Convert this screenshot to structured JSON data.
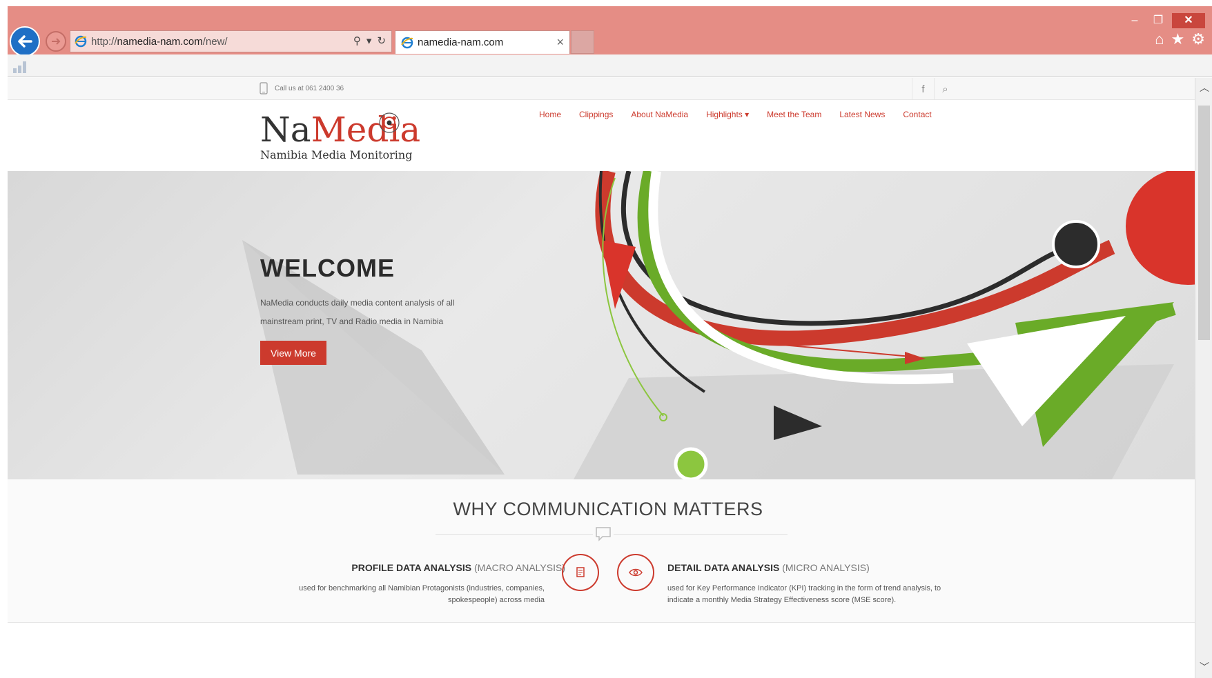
{
  "browser": {
    "address": {
      "prefix": "http://",
      "host": "namedia-nam.com",
      "path": "/new/"
    },
    "tab_title": "namedia-nam.com",
    "tab_close": "×",
    "window_buttons": {
      "minimize": "‒",
      "restore": "❐",
      "close": "✕"
    },
    "icons": {
      "back": "back-arrow-icon",
      "forward": "forward-arrow-icon",
      "home": "home-icon",
      "favorites": "star-icon",
      "settings": "gear-icon"
    }
  },
  "topbar": {
    "phone_text": "Call us at 061 2400 36",
    "facebook_icon": "f",
    "search_icon": "⌕"
  },
  "logo": {
    "na": "Na",
    "media": "Media",
    "tagline": "Namibia Media Monitoring"
  },
  "nav": [
    {
      "label": "Home"
    },
    {
      "label": "Clippings"
    },
    {
      "label": "About NaMedia"
    },
    {
      "label": "Highlights ▾"
    },
    {
      "label": "Meet the Team"
    },
    {
      "label": "Latest News"
    },
    {
      "label": "Contact"
    }
  ],
  "hero": {
    "title": "WELCOME",
    "description": "NaMedia conducts daily media content analysis of all mainstream print, TV and Radio media in Namibia",
    "button": "View More"
  },
  "why": {
    "title": "WHY COMMUNICATION MATTERS",
    "left": {
      "title_bold": "PROFILE DATA ANALYSIS",
      "title_sub": " (MACRO ANALYSIS)",
      "description": "used for benchmarking all Namibian Protagonists (industries, companies, spokespeople) across media",
      "icon": "document-icon"
    },
    "right": {
      "title_bold": "DETAIL DATA ANALYSIS",
      "title_sub": " (MICRO ANALYSIS)",
      "description": "used for Key Performance Indicator (KPI) tracking in the form of trend analysis, to indicate a monthly Media Strategy Effectiveness score (MSE score).",
      "icon": "eye-icon"
    }
  },
  "colors": {
    "accent": "#cc3a2d",
    "titlebar": "#e58d85",
    "green": "#7cb82f"
  }
}
